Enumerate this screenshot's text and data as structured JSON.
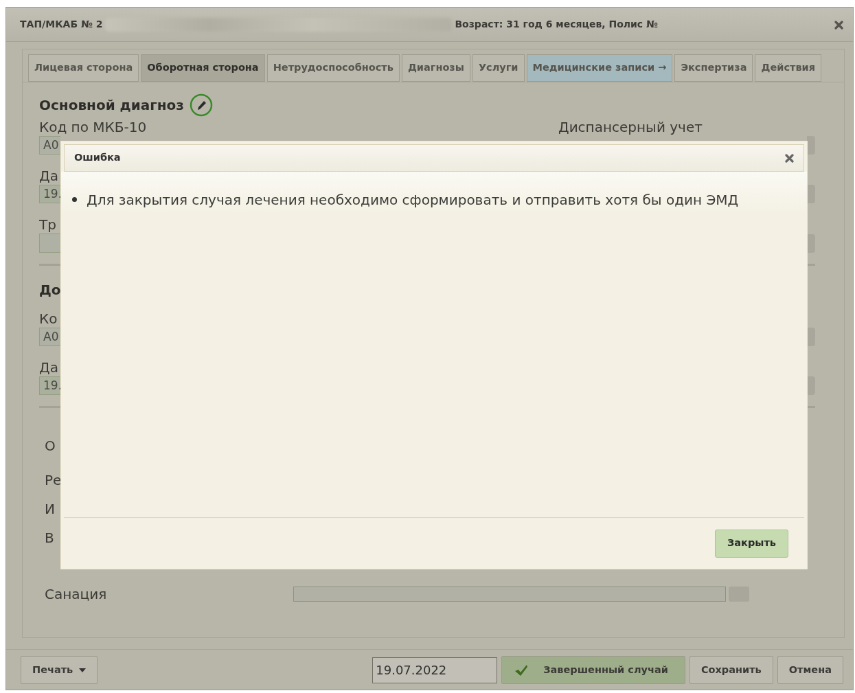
{
  "window": {
    "title_prefix": "ТАП/МКАБ № 2",
    "title_info": "Возраст: 31 год 6 месяцев, Полис №"
  },
  "tabs": [
    {
      "label": "Лицевая сторона",
      "selected": false,
      "highlighted": false
    },
    {
      "label": "Оборотная сторона",
      "selected": true,
      "highlighted": false
    },
    {
      "label": "Нетрудоспособность",
      "selected": false,
      "highlighted": false
    },
    {
      "label": "Диагнозы",
      "selected": false,
      "highlighted": false
    },
    {
      "label": "Услуги",
      "selected": false,
      "highlighted": false
    },
    {
      "label": "Медицинские записи →",
      "selected": false,
      "highlighted": true
    },
    {
      "label": "Экспертиза",
      "selected": false,
      "highlighted": false
    },
    {
      "label": "Действия",
      "selected": false,
      "highlighted": false
    }
  ],
  "main_diagnosis": {
    "heading": "Основной диагноз",
    "code_label": "Код по МКБ-10",
    "code_value": "A0",
    "dispensary_label": "Диспансерный учет",
    "date_label": "Да",
    "date_value": "19.",
    "trauma_label": "Тр"
  },
  "additional_diagnosis": {
    "heading": "До",
    "code_label": "Ко",
    "code_value": "A0",
    "date_label": "Да",
    "date_value": "19."
  },
  "other_labels": [
    "О",
    "Ре",
    "И",
    "В",
    "Санация"
  ],
  "error_dialog": {
    "title": "Ошибка",
    "messages": [
      "Для закрытия случая лечения необходимо сформировать и отправить хотя бы один ЭМД"
    ],
    "close_button": "Закрыть"
  },
  "footer": {
    "print_button": "Печать",
    "date_value": "19.07.2022",
    "completed_button": "Завершенный случай",
    "save_button": "Сохранить",
    "cancel_button": "Отмена"
  }
}
